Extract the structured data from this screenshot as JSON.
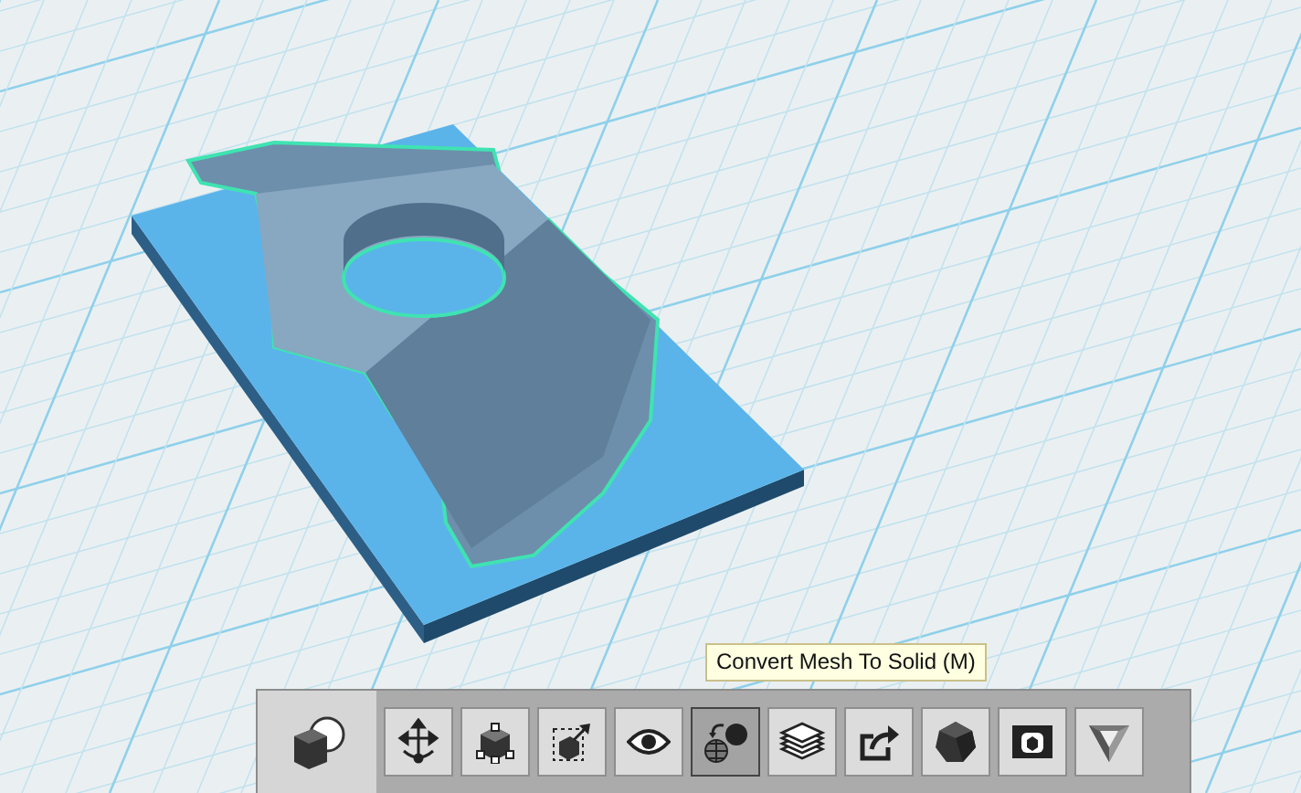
{
  "tooltip": {
    "text": "Convert Mesh To Solid (M)"
  },
  "toolbar": {
    "items": [
      {
        "kind": "primitives",
        "selected": false
      },
      {
        "kind": "move",
        "selected": false
      },
      {
        "kind": "pivot",
        "selected": false
      },
      {
        "kind": "scale",
        "selected": false
      },
      {
        "kind": "visibility",
        "selected": false
      },
      {
        "kind": "convert",
        "selected": true
      },
      {
        "kind": "layers",
        "selected": false
      },
      {
        "kind": "export",
        "selected": false
      },
      {
        "kind": "polyhedron",
        "selected": false
      },
      {
        "kind": "frame",
        "selected": false
      },
      {
        "kind": "triangle",
        "selected": false
      }
    ]
  }
}
